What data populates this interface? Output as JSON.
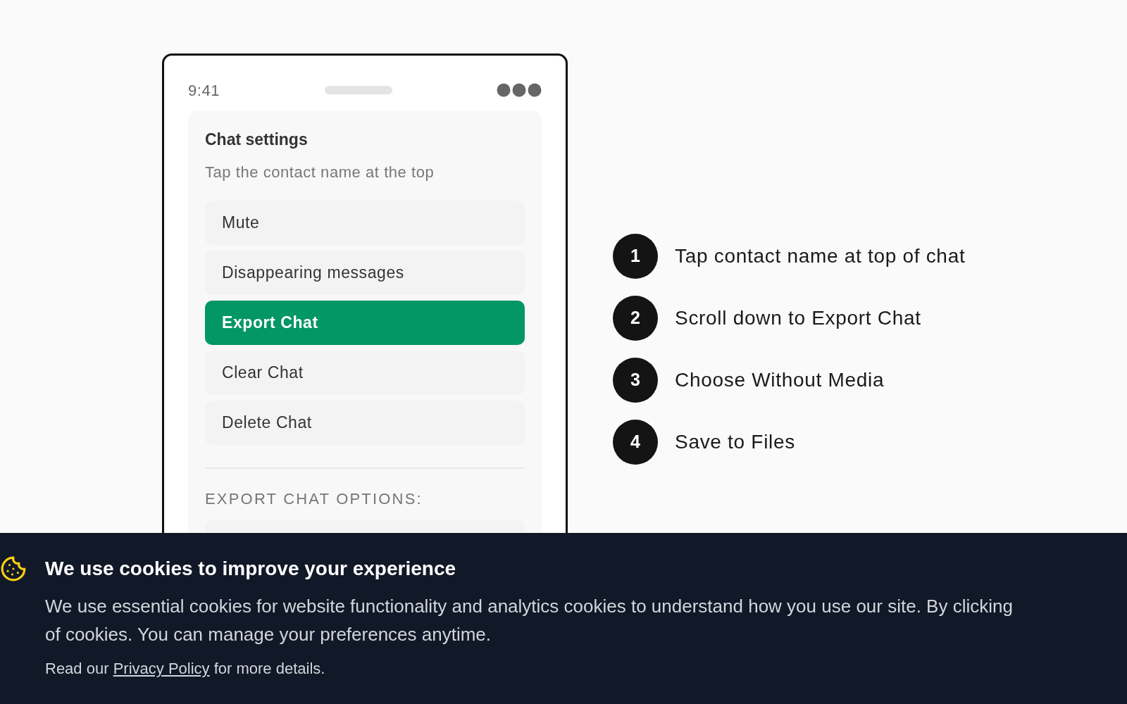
{
  "phone": {
    "time": "9:41",
    "card": {
      "title": "Chat settings",
      "subtitle": "Tap the contact name at the top",
      "items": [
        {
          "label": "Mute",
          "selected": false
        },
        {
          "label": "Disappearing messages",
          "selected": false
        },
        {
          "label": "Export Chat",
          "selected": true
        },
        {
          "label": "Clear Chat",
          "selected": false
        },
        {
          "label": "Delete Chat",
          "selected": false
        }
      ],
      "section_heading": "EXPORT CHAT OPTIONS:"
    }
  },
  "steps": [
    {
      "number": "1",
      "text": "Tap contact name at top of chat"
    },
    {
      "number": "2",
      "text": "Scroll down to Export Chat"
    },
    {
      "number": "3",
      "text": "Choose Without Media"
    },
    {
      "number": "4",
      "text": "Save to Files"
    }
  ],
  "cookie_banner": {
    "title": "We use cookies to improve your experience",
    "lines": [
      "We use essential cookies for website functionality and analytics cookies to understand how you use our site. By clicking",
      "of cookies. You can manage your preferences anytime."
    ],
    "footer_before": "Read our",
    "link": "Privacy Policy",
    "footer_after": "for more details."
  }
}
